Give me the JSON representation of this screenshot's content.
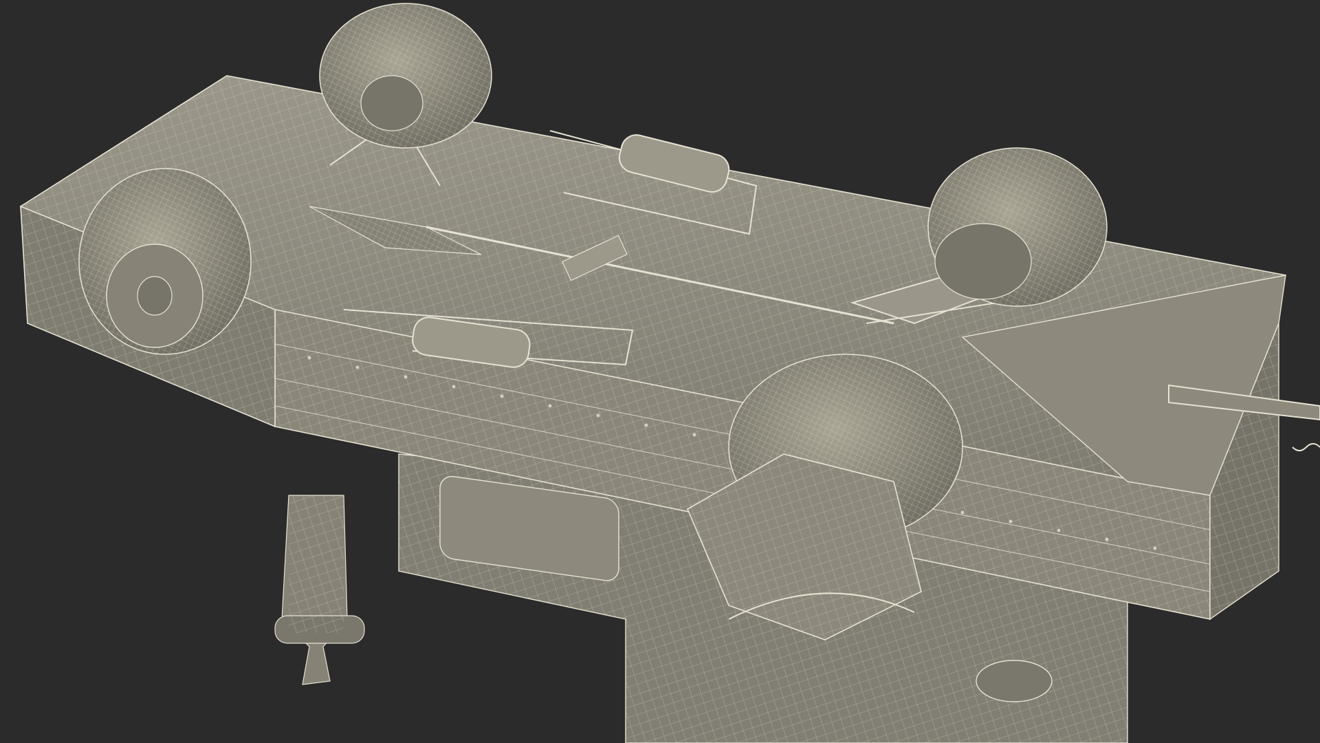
{
  "scene": {
    "background_color": "#2b2b2b",
    "surface_color": "#8f8c7f",
    "surface_shadow_color": "#5f5d54",
    "surface_light_color": "#aaa796",
    "wire_color": "#e6e3d3",
    "subject": "wireframe-3d-model-vehicle-underside-with-stand"
  }
}
